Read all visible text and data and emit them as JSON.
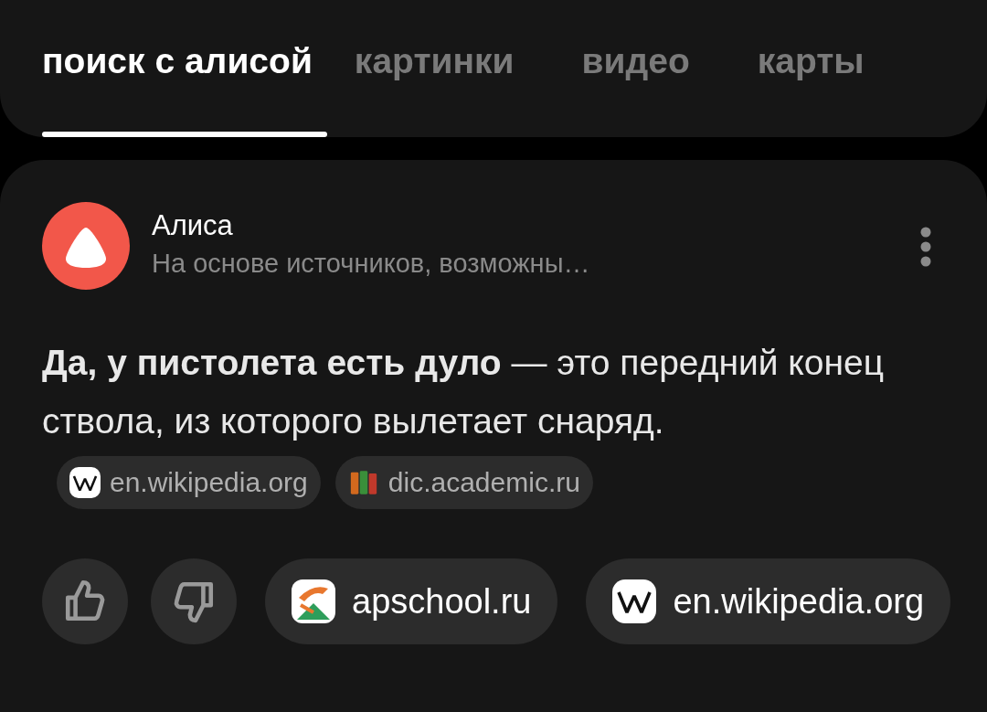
{
  "tabs": [
    {
      "label": "поиск с алисой",
      "selected": true
    },
    {
      "label": "картинки",
      "selected": false
    },
    {
      "label": "видео",
      "selected": false
    },
    {
      "label": "карты",
      "selected": false
    }
  ],
  "answer": {
    "author": "Алиса",
    "subtitle": "На основе источников, возможны…",
    "text": "**Да, у пистолета есть дуло** — это передний конец ствола, из которого вылетает снаряд.",
    "inline_sources": [
      {
        "kind": "wiki",
        "label": "en.wikipedia.org"
      },
      {
        "kind": "books",
        "label": "dic.academic.ru"
      }
    ],
    "sources": [
      {
        "kind": "school",
        "label": "apschool.ru"
      },
      {
        "kind": "wiki",
        "label": "en.wikipedia.org"
      }
    ]
  }
}
